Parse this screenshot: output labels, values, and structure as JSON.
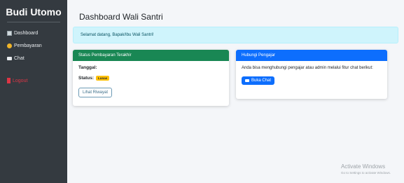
{
  "sidebar": {
    "brand": "Budi Utomo",
    "items": [
      {
        "label": "Dashboard",
        "icon": "dashboard-icon"
      },
      {
        "label": "Pembayaran",
        "icon": "money-icon"
      },
      {
        "label": "Chat",
        "icon": "chat-icon"
      },
      {
        "label": "Logout",
        "icon": "logout-icon"
      }
    ]
  },
  "main": {
    "title": "Dashboard Wali Santri",
    "alert": "Selamat datang, Bapak/Ibu Wali Santri!",
    "status_card": {
      "header": "Status Pembayaran Terakhir",
      "tanggal_label": "Tanggal:",
      "status_label": "Status:",
      "status_badge": "Lunas",
      "button": "Lihat Riwayat"
    },
    "contact_card": {
      "header": "Hubungi Pengajar",
      "text": "Anda bisa menghubungi pengajar atau admin melalui fitur chat berikut:",
      "button": "Buka Chat"
    }
  },
  "watermark": {
    "title": "Activate Windows",
    "subtitle": "Go to Settings to activate Windows."
  },
  "colors": {
    "sidebar_bg": "#343a40",
    "success": "#198754",
    "primary": "#0d6efd",
    "info_bg": "#cff4fc",
    "warning": "#ffc107",
    "danger": "#dc3545"
  }
}
